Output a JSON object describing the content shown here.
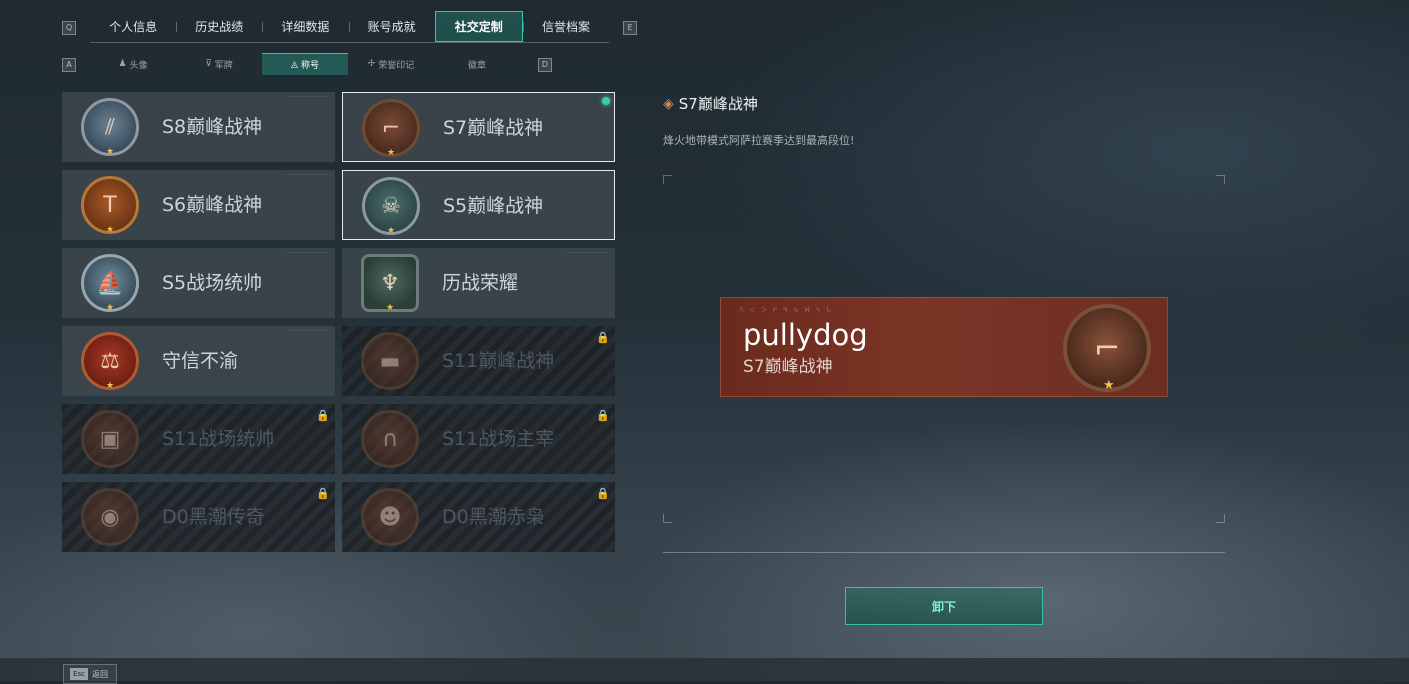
{
  "tabs": {
    "left_key": "Q",
    "right_key": "E",
    "items": [
      {
        "label": "个人信息"
      },
      {
        "label": "历史战绩"
      },
      {
        "label": "详细数据"
      },
      {
        "label": "账号成就"
      },
      {
        "label": "社交定制",
        "active": true
      },
      {
        "label": "信誉档案"
      }
    ]
  },
  "subtabs": {
    "left_key": "A",
    "right_key": "D",
    "items": [
      {
        "label": "头像",
        "icon": "person-icon"
      },
      {
        "label": "军牌",
        "icon": "dogtag-icon"
      },
      {
        "label": "称号",
        "icon": "title-icon",
        "active": true
      },
      {
        "label": "荣誉印记",
        "icon": "honor-icon"
      },
      {
        "label": "徽章",
        "icon": ""
      }
    ]
  },
  "titles": [
    {
      "name": "S8巅峰战神",
      "emblem": "blue",
      "glyph": "⫽",
      "star": true,
      "locked": false
    },
    {
      "name": "S7巅峰战神",
      "emblem": "",
      "glyph": "⌐",
      "star": true,
      "locked": false,
      "selected": true,
      "equipped": true
    },
    {
      "name": "S6巅峰战神",
      "emblem": "gold",
      "glyph": "T",
      "star": true,
      "locked": false
    },
    {
      "name": "S5巅峰战神",
      "emblem": "teal",
      "glyph": "☠",
      "star": true,
      "locked": false,
      "selected": true
    },
    {
      "name": "S5战场统帅",
      "emblem": "boat",
      "glyph": "⛵",
      "star": true,
      "locked": false
    },
    {
      "name": "历战荣耀",
      "emblem": "hex",
      "glyph": "♆",
      "star": true,
      "locked": false
    },
    {
      "name": "守信不渝",
      "emblem": "red",
      "glyph": "⚖",
      "star": true,
      "locked": false
    },
    {
      "name": "S11巅峰战神",
      "emblem": "",
      "glyph": "▬",
      "star": false,
      "locked": true
    },
    {
      "name": "S11战场统帅",
      "emblem": "",
      "glyph": "▣",
      "star": false,
      "locked": true
    },
    {
      "name": "S11战场主宰",
      "emblem": "",
      "glyph": "∩",
      "star": false,
      "locked": true
    },
    {
      "name": "D0黑潮传奇",
      "emblem": "",
      "glyph": "◉",
      "star": false,
      "locked": true
    },
    {
      "name": "D0黑潮赤枭",
      "emblem": "",
      "glyph": "☻",
      "star": false,
      "locked": true
    }
  ],
  "detail": {
    "title": "S7巅峰战神",
    "description": "烽火地带模式阿萨拉赛季达到最高段位!"
  },
  "nameplate": {
    "player_name": "pullydog",
    "title": "S7巅峰战神",
    "runes": "ᐱ ᐸ ᐳ ᑭ ᑫ ᑲ ᕼ ᓴ ᒐ"
  },
  "button": {
    "unequip": "卸下"
  },
  "bottom": {
    "back_key": "Esc",
    "back_label": "返回"
  },
  "colors": {
    "accent": "#37c3a2",
    "equipped_dot": "#37d19c",
    "star": "#f2c14e"
  }
}
